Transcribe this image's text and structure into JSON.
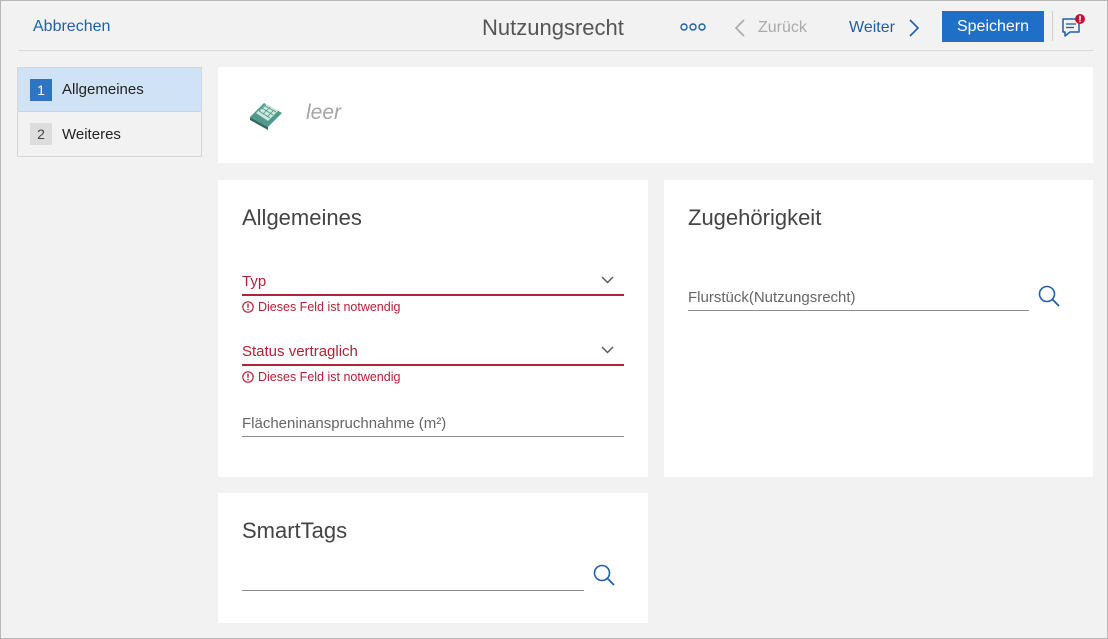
{
  "header": {
    "cancel_label": "Abbrechen",
    "title": "Nutzungsrecht",
    "more_icon": "more-dots-icon",
    "back_label": "Zurück",
    "forward_label": "Weiter",
    "save_label": "Speichern",
    "chat_icon": "chat-notification-icon"
  },
  "sidebar": {
    "steps": [
      {
        "number": "1",
        "label": "Allgemeines",
        "active": true
      },
      {
        "number": "2",
        "label": "Weiteres",
        "active": false
      }
    ]
  },
  "entity": {
    "icon": "land-parcel-icon",
    "name": "leer"
  },
  "general": {
    "title": "Allgemeines",
    "fields": [
      {
        "label": "Typ",
        "error": "Dieses Feld ist notwendig"
      },
      {
        "label": "Status vertraglich",
        "error": "Dieses Feld ist notwendig"
      },
      {
        "label": "Flächeninanspruchnahme (m²)"
      }
    ]
  },
  "membership": {
    "title": "Zugehörigkeit",
    "field_label": "Flurstück(Nutzungsrecht)"
  },
  "tags": {
    "title": "SmartTags",
    "value": ""
  },
  "colors": {
    "accent": "#1f6fc6",
    "link": "#1f5fa8",
    "error": "#b22236",
    "active_step_bg": "#cfe2f6",
    "background": "#f2f2f2"
  }
}
